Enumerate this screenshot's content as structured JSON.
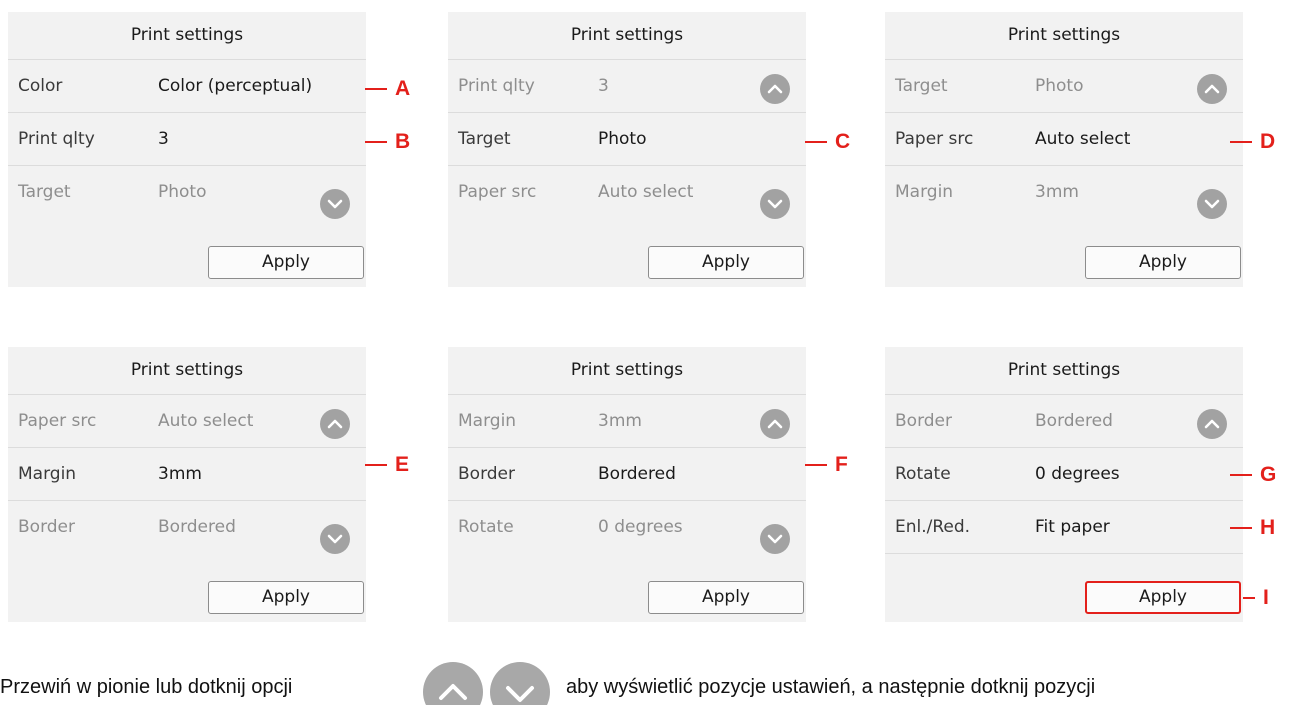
{
  "panel_title": "Print settings",
  "apply_label": "Apply",
  "panels": [
    {
      "rows": [
        {
          "label": "Color",
          "value": "Color (perceptual)"
        },
        {
          "label": "Print qlty",
          "value": "3"
        },
        {
          "label": "Target",
          "value": "Photo"
        }
      ],
      "callouts": [
        "A",
        "B"
      ]
    },
    {
      "rows": [
        {
          "label": "Print qlty",
          "value": "3"
        },
        {
          "label": "Target",
          "value": "Photo"
        },
        {
          "label": "Paper src",
          "value": "Auto select"
        }
      ],
      "callouts": [
        "C"
      ]
    },
    {
      "rows": [
        {
          "label": "Target",
          "value": "Photo"
        },
        {
          "label": "Paper src",
          "value": "Auto select"
        },
        {
          "label": "Margin",
          "value": "3mm"
        }
      ],
      "callouts": [
        "D"
      ]
    },
    {
      "rows": [
        {
          "label": "Paper src",
          "value": "Auto select"
        },
        {
          "label": "Margin",
          "value": "3mm"
        },
        {
          "label": "Border",
          "value": "Bordered"
        }
      ],
      "callouts": [
        "E"
      ]
    },
    {
      "rows": [
        {
          "label": "Margin",
          "value": "3mm"
        },
        {
          "label": "Border",
          "value": "Bordered"
        },
        {
          "label": "Rotate",
          "value": "0 degrees"
        }
      ],
      "callouts": [
        "F"
      ]
    },
    {
      "rows": [
        {
          "label": "Border",
          "value": "Bordered"
        },
        {
          "label": "Rotate",
          "value": "0 degrees"
        },
        {
          "label": "Enl./Red.",
          "value": "Fit paper"
        }
      ],
      "callouts": [
        "G",
        "H",
        "I"
      ]
    }
  ],
  "footer": {
    "text_before": "Przewiń w pionie lub dotknij opcji",
    "text_after": "aby wyświetlić pozycje ustawień, a następnie dotknij pozycji"
  },
  "icons": {
    "scroll_up": "chevron-up-icon",
    "scroll_down": "chevron-down-icon"
  },
  "colors": {
    "callout": "#e3201b",
    "scroll_button": "#a2a2a2",
    "panel_background": "#f2f2f2"
  }
}
